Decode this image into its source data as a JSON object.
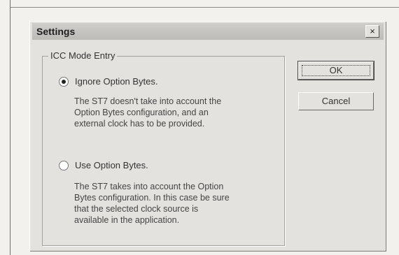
{
  "window": {
    "title": "Settings",
    "close_label": "×"
  },
  "group": {
    "label": "ICC Mode Entry"
  },
  "options": [
    {
      "label": "Ignore Option Bytes.",
      "description": "The ST7 doesn't take into account the\nOption Bytes configuration, and an\nexternal clock has to be provided.",
      "selected": true
    },
    {
      "label": "Use Option Bytes.",
      "description": "The ST7 takes into account the Option\nBytes configuration. In this case be sure\nthat the selected clock source is\navailable in the application.",
      "selected": false
    }
  ],
  "buttons": {
    "ok": "OK",
    "cancel": "Cancel"
  }
}
